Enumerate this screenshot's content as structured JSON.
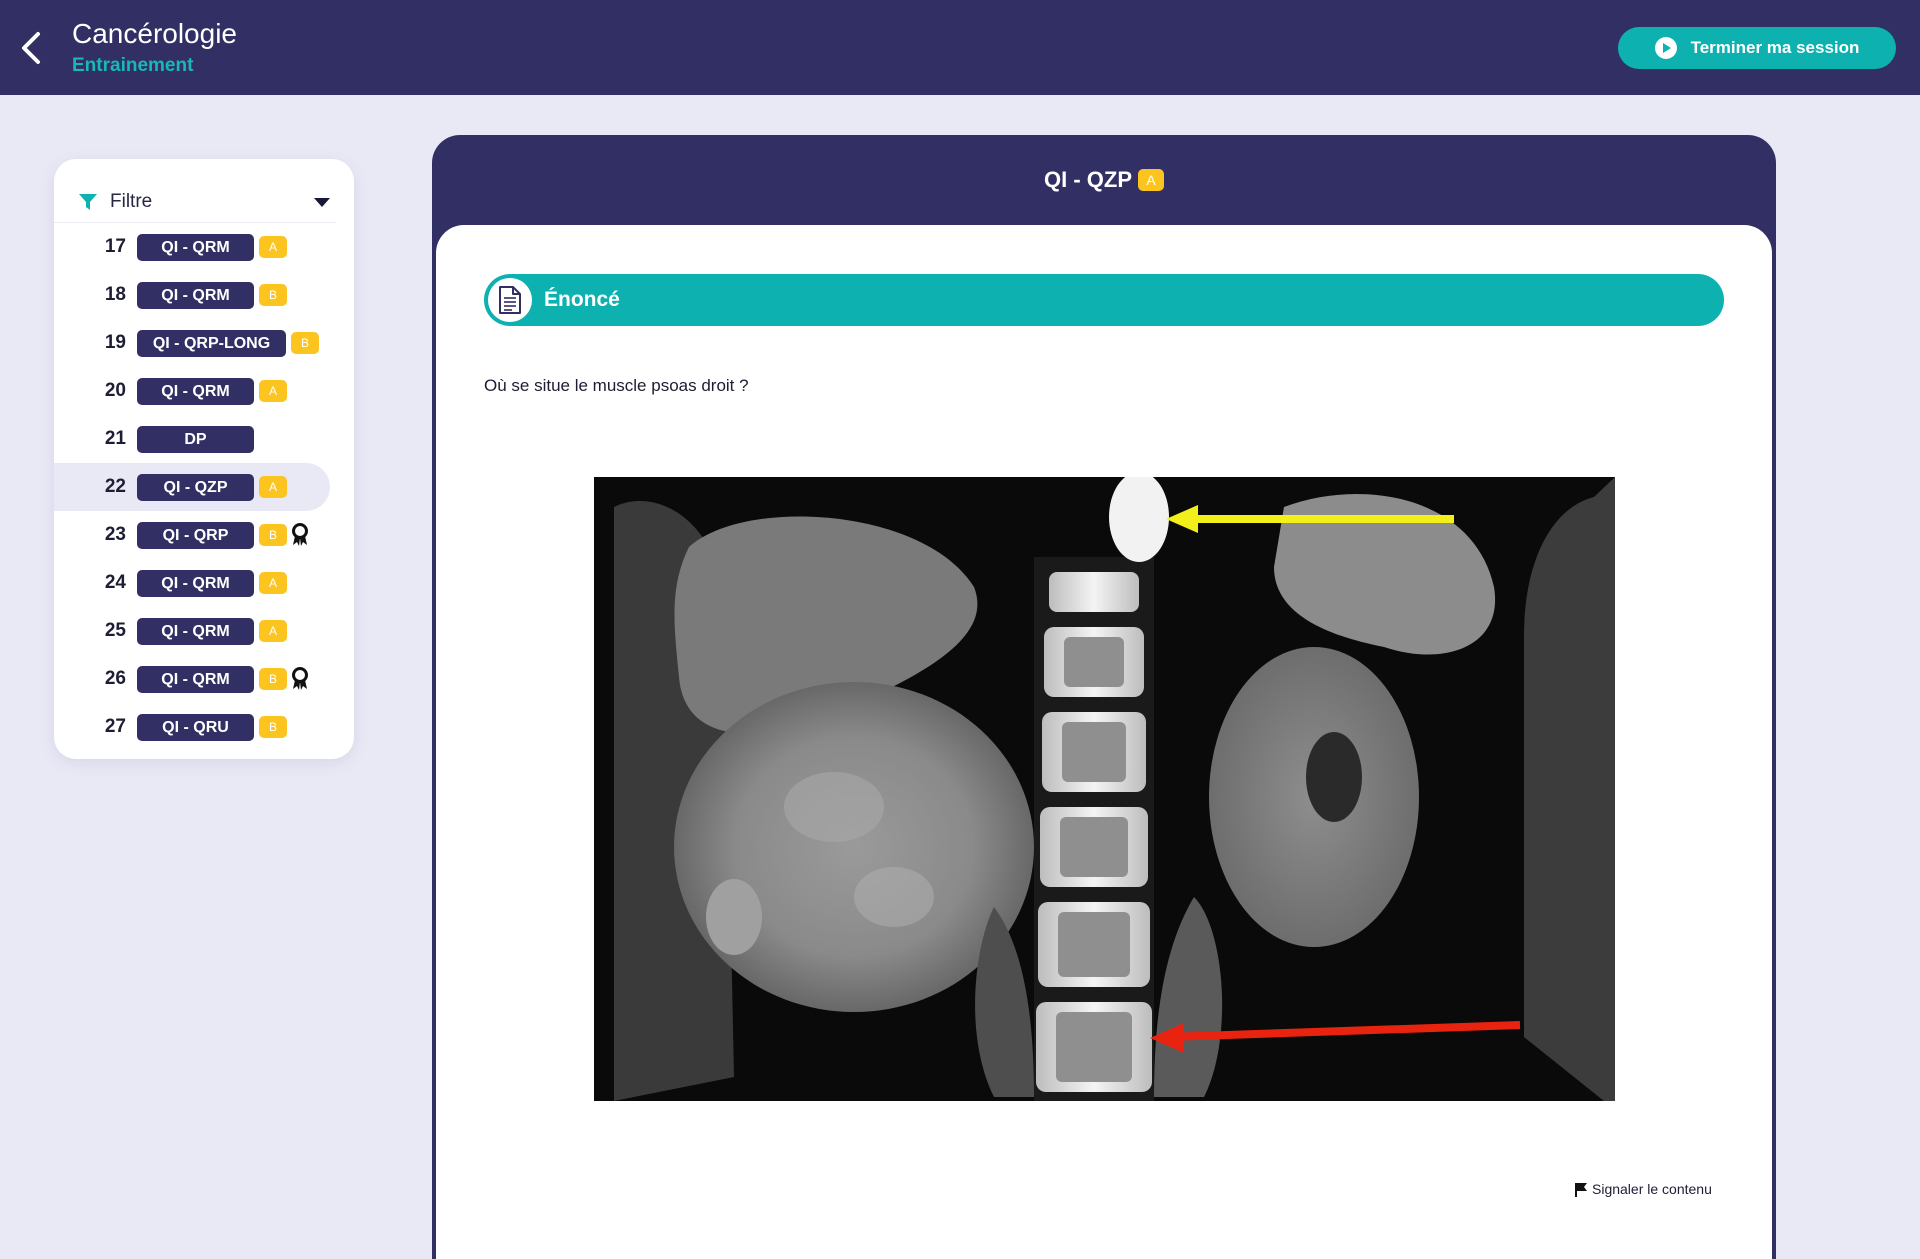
{
  "header": {
    "title": "Cancérologie",
    "subtitle": "Entrainement",
    "end_session_label": "Terminer ma session"
  },
  "sidebar": {
    "filter_label": "Filtre",
    "questions": [
      {
        "num": "17",
        "label": "QI - QRM",
        "level": "A",
        "award": false,
        "active": false
      },
      {
        "num": "18",
        "label": "QI - QRM",
        "level": "B",
        "award": false,
        "active": false
      },
      {
        "num": "19",
        "label": "QI - QRP-LONG",
        "level": "B",
        "award": false,
        "active": false
      },
      {
        "num": "20",
        "label": "QI - QRM",
        "level": "A",
        "award": false,
        "active": false
      },
      {
        "num": "21",
        "label": "DP",
        "level": "",
        "award": false,
        "active": false
      },
      {
        "num": "22",
        "label": "QI - QZP",
        "level": "A",
        "award": false,
        "active": true
      },
      {
        "num": "23",
        "label": "QI - QRP",
        "level": "B",
        "award": true,
        "active": false
      },
      {
        "num": "24",
        "label": "QI - QRM",
        "level": "A",
        "award": false,
        "active": false
      },
      {
        "num": "25",
        "label": "QI - QRM",
        "level": "A",
        "award": false,
        "active": false
      },
      {
        "num": "26",
        "label": "QI - QRM",
        "level": "B",
        "award": true,
        "active": false
      },
      {
        "num": "27",
        "label": "QI - QRU",
        "level": "B",
        "award": false,
        "active": false
      }
    ]
  },
  "main": {
    "title": "QI - QZP",
    "level": "A",
    "section_label": "Énoncé",
    "question": "Où se situe le muscle psoas droit ?",
    "report_label": "Signaler le contenu"
  },
  "colors": {
    "navy": "#322f64",
    "teal": "#0db1b0",
    "badge_yellow": "#fcc41e",
    "background": "#e9e9f6",
    "arrow_yellow": "#f2ef1a",
    "arrow_red": "#e8230f"
  },
  "icons": [
    "chevron-left-icon",
    "play-circle-icon",
    "funnel-icon",
    "caret-down-icon",
    "document-icon",
    "award-icon",
    "flag-icon"
  ]
}
